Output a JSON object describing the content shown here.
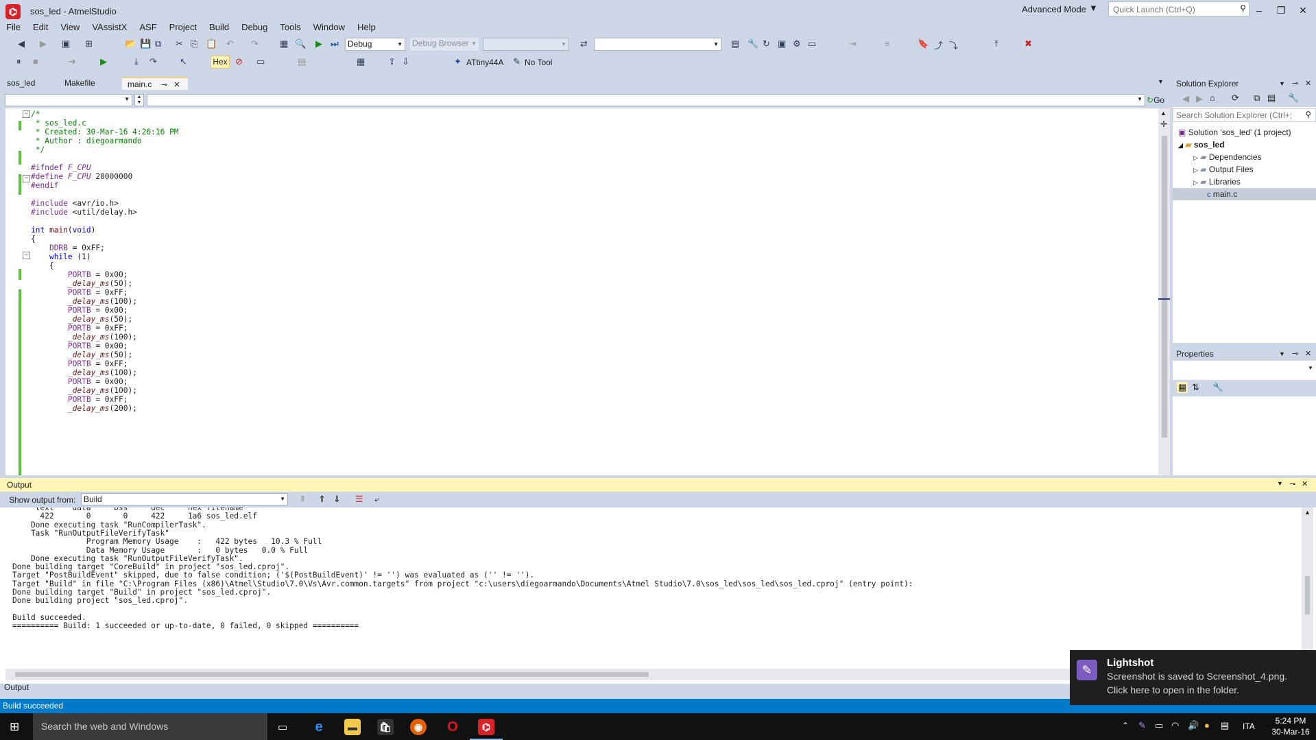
{
  "window": {
    "title": "sos_led - AtmelStudio",
    "mode": "Advanced Mode",
    "quick_launch_placeholder": "Quick Launch (Ctrl+Q)"
  },
  "menu": [
    "File",
    "Edit",
    "View",
    "VAssistX",
    "ASF",
    "Project",
    "Build",
    "Debug",
    "Tools",
    "Window",
    "Help"
  ],
  "toolbar": {
    "config": "Debug",
    "debug_browser": "Debug Browser",
    "hex_label": "Hex",
    "device": "ATtiny44A",
    "tool": "No Tool",
    "go_label": "Go"
  },
  "doc_tabs": [
    "sos_led",
    "Makefile",
    "main.c"
  ],
  "code_lines": [
    {
      "html": "<span class=\"c\">/*</span>"
    },
    {
      "html": "<span class=\"c\"> * sos_led.c</span>"
    },
    {
      "html": "<span class=\"c\"> * Created: 30-Mar-16 4:26:16 PM</span>"
    },
    {
      "html": "<span class=\"c\"> * Author : diegoarmando</span>"
    },
    {
      "html": "<span class=\"c\"> */</span>"
    },
    {
      "html": ""
    },
    {
      "html": "<span class=\"pp\">#ifndef</span> <span class=\"m\">F_CPU</span>"
    },
    {
      "html": "<span class=\"pp\">#define</span> <span class=\"m\">F_CPU</span> 20000000"
    },
    {
      "html": "<span class=\"pp\">#endif</span>"
    },
    {
      "html": ""
    },
    {
      "html": "<span class=\"pp\">#include</span> &lt;avr/io.h&gt;"
    },
    {
      "html": "<span class=\"pp\">#include</span> &lt;util/delay.h&gt;"
    },
    {
      "html": ""
    },
    {
      "html": "<span class=\"k\">int</span> <span class=\"f\">main</span>(<span class=\"k\">void</span>)"
    },
    {
      "html": "{"
    },
    {
      "html": "    <span class=\"pp\">DDRB</span> = 0xFF;"
    },
    {
      "html": "    <span class=\"k\">while</span> (1)"
    },
    {
      "html": "    {"
    },
    {
      "html": "        <span class=\"pp\">PORTB</span> = 0x00;"
    },
    {
      "html": "        <span class=\"it\">_delay_ms</span>(50);"
    },
    {
      "html": "        <span class=\"pp\">PORTB</span> = 0xFF;"
    },
    {
      "html": "        <span class=\"it\">_delay_ms</span>(100);"
    },
    {
      "html": "        <span class=\"pp\">PORTB</span> = 0x00;"
    },
    {
      "html": "        <span class=\"it\">_delay_ms</span>(50);"
    },
    {
      "html": "        <span class=\"pp\">PORTB</span> = 0xFF;"
    },
    {
      "html": "        <span class=\"it\">_delay_ms</span>(100);"
    },
    {
      "html": "        <span class=\"pp\">PORTB</span> = 0x00;"
    },
    {
      "html": "        <span class=\"it\">_delay_ms</span>(50);"
    },
    {
      "html": "        <span class=\"pp\">PORTB</span> = 0xFF;"
    },
    {
      "html": "        <span class=\"it\">_delay_ms</span>(100);"
    },
    {
      "html": "        <span class=\"pp\">PORTB</span> = 0x00;"
    },
    {
      "html": "        <span class=\"it\">_delay_ms</span>(100);"
    },
    {
      "html": "        <span class=\"pp\">PORTB</span> = 0xFF;"
    },
    {
      "html": "        <span class=\"it\">_delay_ms</span>(200);"
    }
  ],
  "solution_explorer": {
    "title": "Solution Explorer",
    "search_placeholder": "Search Solution Explorer (Ctrl+;",
    "items": [
      "Solution 'sos_led' (1 project)",
      "sos_led",
      "Dependencies",
      "Output Files",
      "Libraries",
      "main.c"
    ]
  },
  "properties": {
    "title": "Properties"
  },
  "output": {
    "title": "Output",
    "show_from_label": "Show output from:",
    "source": "Build",
    "lines": [
      "     text    data     bss     dec     hex filename",
      "      422       0       0     422     1a6 sos_led.elf",
      "    Done executing task \"RunCompilerTask\".",
      "    Task \"RunOutputFileVerifyTask\"",
      "                Program Memory Usage    :   422 bytes   10.3 % Full",
      "                Data Memory Usage       :   0 bytes   0.0 % Full",
      "    Done executing task \"RunOutputFileVerifyTask\".",
      "Done building target \"CoreBuild\" in project \"sos_led.cproj\".",
      "Target \"PostBuildEvent\" skipped, due to false condition; ('$(PostBuildEvent)' != '') was evaluated as ('' != '').",
      "Target \"Build\" in file \"C:\\Program Files (x86)\\Atmel\\Studio\\7.0\\Vs\\Avr.common.targets\" from project \"c:\\users\\diegoarmando\\Documents\\Atmel Studio\\7.0\\sos_led\\sos_led\\sos_led.cproj\" (entry point):",
      "Done building target \"Build\" in project \"sos_led.cproj\".",
      "Done building project \"sos_led.cproj\".",
      "",
      "Build succeeded.",
      "========== Build: 1 succeeded or up-to-date, 0 failed, 0 skipped =========="
    ],
    "tab_label": "Output"
  },
  "status": {
    "text": "Build succeeded"
  },
  "taskbar": {
    "search": "Search the web and Windows",
    "lang": "ITA",
    "time": "5:24 PM",
    "date": "30-Mar-16"
  },
  "toast": {
    "title": "Lightshot",
    "line1": "Screenshot is saved to Screenshot_4.png.",
    "line2": "Click here to open in the folder."
  }
}
